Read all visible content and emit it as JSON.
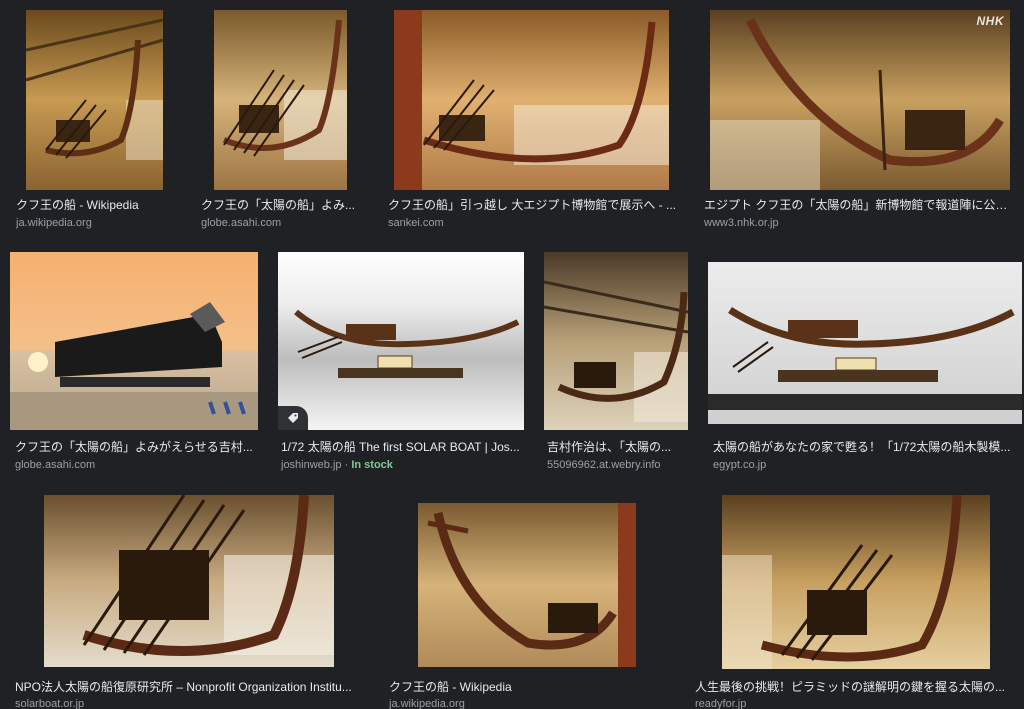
{
  "results": [
    {
      "title": "クフ王の船 - Wikipedia",
      "source": "ja.wikipedia.org"
    },
    {
      "title": "クフ王の「太陽の船」よみ...",
      "source": "globe.asahi.com"
    },
    {
      "title": "クフ王の船」引っ越し 大エジプト博物館で展示へ - ...",
      "source": "sankei.com"
    },
    {
      "title": "エジプト クフ王の「太陽の船」新博物館で報道陣に公開...",
      "source": "www3.nhk.or.jp",
      "watermark": "NHK"
    },
    {
      "title": "クフ王の「太陽の船」よみがえらせる吉村...",
      "source": "globe.asahi.com"
    },
    {
      "title": "1/72 太陽の船 The first SOLAR BOAT | Jos...",
      "source": "joshinweb.jp",
      "stock_sep": " · ",
      "stock": "In stock",
      "icon": "tag-icon"
    },
    {
      "title": "吉村作治は、「太陽の...",
      "source": "55096962.at.webry.info"
    },
    {
      "title": "太陽の船があなたの家で甦る！「1/72太陽の船木製模...",
      "source": "egypt.co.jp"
    },
    {
      "title": "NPO法人太陽の船復原研究所 – Nonprofit Organization Institu...",
      "source": "solarboat.or.jp"
    },
    {
      "title": "クフ王の船 - Wikipedia",
      "source": "ja.wikipedia.org"
    },
    {
      "title": "人生最後の挑戦！ピラミッドの謎解明の鍵を握る太陽の...",
      "source": "readyfor.jp"
    }
  ],
  "colors": {
    "background": "#202124",
    "caption": "#e8eaed",
    "source": "#9aa0a6",
    "in_stock": "#81c995"
  }
}
